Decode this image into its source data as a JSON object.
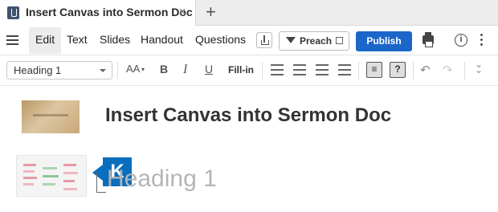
{
  "tab": {
    "title": "Insert Canvas into Sermon Doc",
    "close": "×",
    "new": "+"
  },
  "menu": {
    "items": [
      "Edit",
      "Text",
      "Slides",
      "Handout",
      "Questions"
    ],
    "preach_label": "Preach",
    "publish_label": "Publish",
    "info": "i"
  },
  "toolbar": {
    "style_value": "Heading 1",
    "font_size_label": "AA",
    "bold": "B",
    "italic": "I",
    "underline": "U",
    "fill_in": "Fill-in",
    "show_toggle": "≡",
    "question_toggle": "?",
    "undo": "↶",
    "redo": "↷",
    "collapse": "»"
  },
  "document": {
    "title": "Insert Canvas into Sermon Doc",
    "heading_placeholder": "Heading 1",
    "badge_letter": "K"
  },
  "colors": {
    "accent": "#1b66c9",
    "badge": "#0a6ebd"
  }
}
